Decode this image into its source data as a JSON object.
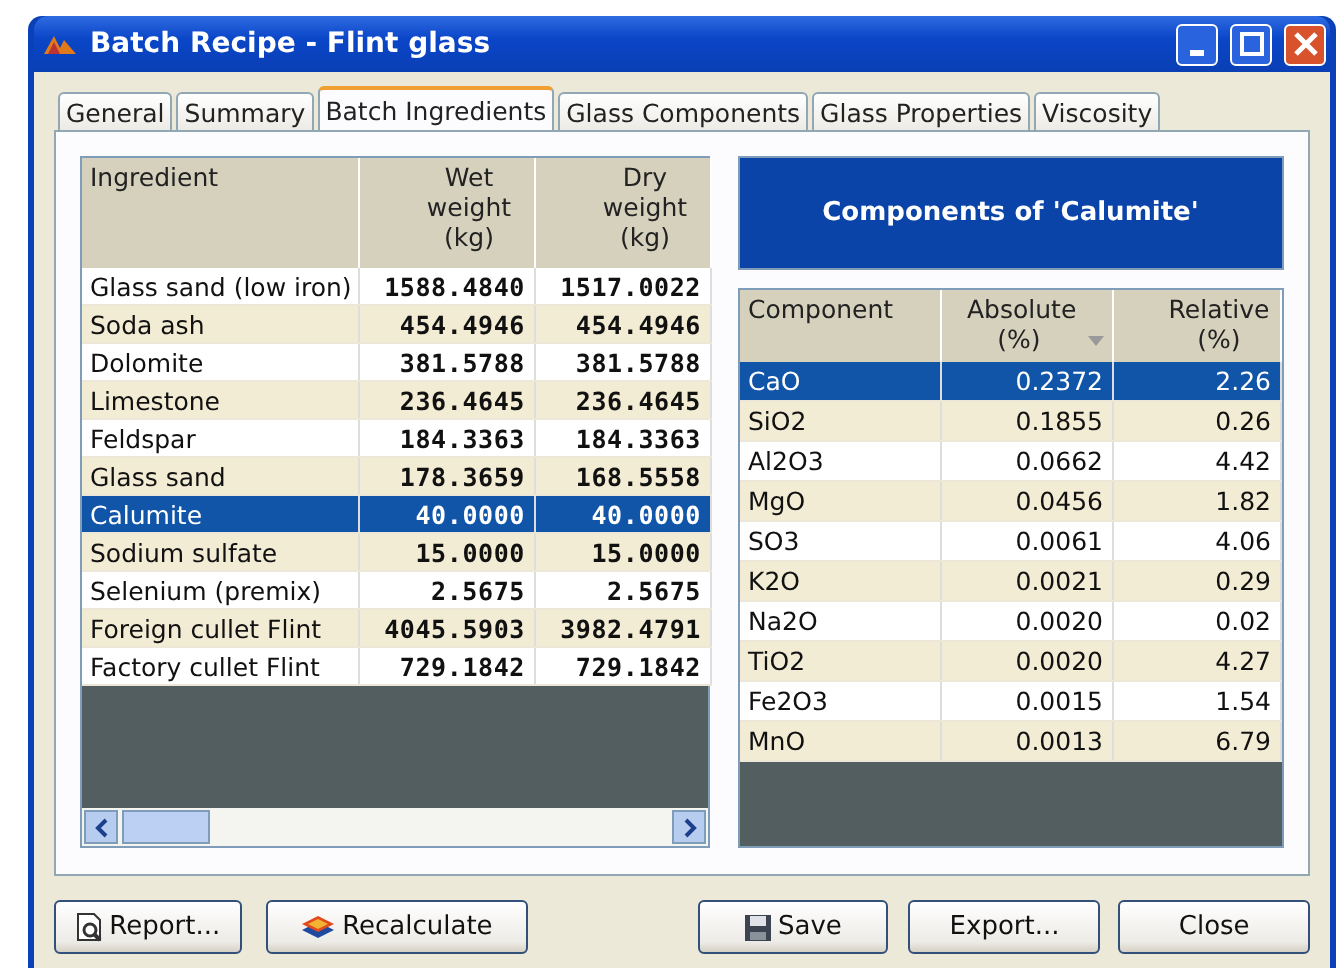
{
  "window": {
    "title": "Batch Recipe - Flint glass"
  },
  "tabs": [
    {
      "label": "General",
      "selected": false
    },
    {
      "label": "Summary",
      "selected": false
    },
    {
      "label": "Batch Ingredients",
      "selected": true
    },
    {
      "label": "Glass Components",
      "selected": false
    },
    {
      "label": "Glass Properties",
      "selected": false
    },
    {
      "label": "Viscosity",
      "selected": false
    }
  ],
  "ingredients": {
    "columns": [
      "Ingredient",
      "Wet weight (kg)",
      "Dry weight (kg)"
    ],
    "rows": [
      {
        "cells": [
          "Glass sand (low iron)",
          "1588.4840",
          "1517.0022"
        ],
        "selected": false
      },
      {
        "cells": [
          "Soda ash",
          "454.4946",
          "454.4946"
        ],
        "selected": false
      },
      {
        "cells": [
          "Dolomite",
          "381.5788",
          "381.5788"
        ],
        "selected": false
      },
      {
        "cells": [
          "Limestone",
          "236.4645",
          "236.4645"
        ],
        "selected": false
      },
      {
        "cells": [
          "Feldspar",
          "184.3363",
          "184.3363"
        ],
        "selected": false
      },
      {
        "cells": [
          "Glass sand",
          "178.3659",
          "168.5558"
        ],
        "selected": false
      },
      {
        "cells": [
          "Calumite",
          "40.0000",
          "40.0000"
        ],
        "selected": true
      },
      {
        "cells": [
          "Sodium sulfate",
          "15.0000",
          "15.0000"
        ],
        "selected": false
      },
      {
        "cells": [
          "Selenium (premix)",
          "2.5675",
          "2.5675"
        ],
        "selected": false
      },
      {
        "cells": [
          "Foreign cullet Flint",
          "4045.5903",
          "3982.4791"
        ],
        "selected": false
      },
      {
        "cells": [
          "Factory cullet Flint",
          "729.1842",
          "729.1842"
        ],
        "selected": false
      }
    ]
  },
  "components_title": "Components of 'Calumite'",
  "components": {
    "columns": [
      "Component",
      "Absolute (%)",
      "Relative (%)"
    ],
    "rows": [
      {
        "cells": [
          "CaO",
          "0.2372",
          "2.26"
        ],
        "selected": true
      },
      {
        "cells": [
          "SiO2",
          "0.1855",
          "0.26"
        ],
        "selected": false
      },
      {
        "cells": [
          "Al2O3",
          "0.0662",
          "4.42"
        ],
        "selected": false
      },
      {
        "cells": [
          "MgO",
          "0.0456",
          "1.82"
        ],
        "selected": false
      },
      {
        "cells": [
          "SO3",
          "0.0061",
          "4.06"
        ],
        "selected": false
      },
      {
        "cells": [
          "K2O",
          "0.0021",
          "0.29"
        ],
        "selected": false
      },
      {
        "cells": [
          "Na2O",
          "0.0020",
          "0.02"
        ],
        "selected": false
      },
      {
        "cells": [
          "TiO2",
          "0.0020",
          "4.27"
        ],
        "selected": false
      },
      {
        "cells": [
          "Fe2O3",
          "0.0015",
          "1.54"
        ],
        "selected": false
      },
      {
        "cells": [
          "MnO",
          "0.0013",
          "6.79"
        ],
        "selected": false
      }
    ]
  },
  "buttons": [
    {
      "label": "Report...",
      "kind": "report"
    },
    {
      "label": "Recalculate",
      "kind": "recalc"
    },
    {
      "label": "Save",
      "kind": "save"
    },
    {
      "label": "Export...",
      "kind": "plain"
    },
    {
      "label": "Close",
      "kind": "plain"
    }
  ]
}
